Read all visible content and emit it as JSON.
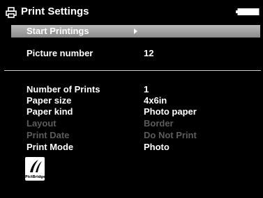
{
  "header": {
    "title": "Print Settings",
    "icon": "printer-icon",
    "status_icon": "battery-icon"
  },
  "menu": {
    "start_label": "Start Printings"
  },
  "picture": {
    "label": "Picture number",
    "value": "12"
  },
  "settings": [
    {
      "label": "Number of Prints",
      "value": "1",
      "enabled": true
    },
    {
      "label": "Paper size",
      "value": "4x6in",
      "enabled": true
    },
    {
      "label": "Paper kind",
      "value": "Photo paper",
      "enabled": true
    },
    {
      "label": "Layout",
      "value": "Border",
      "enabled": false
    },
    {
      "label": "Print Date",
      "value": "Do Not Print",
      "enabled": false
    },
    {
      "label": "Print Mode",
      "value": "Photo",
      "enabled": true
    }
  ],
  "logo": {
    "text": "PictBridge",
    "icon": "pictbridge-logo"
  },
  "colors": {
    "background": "#000000",
    "text": "#ffffff",
    "disabled_text": "#5c5c5c",
    "highlight": "#a0a0a0"
  }
}
